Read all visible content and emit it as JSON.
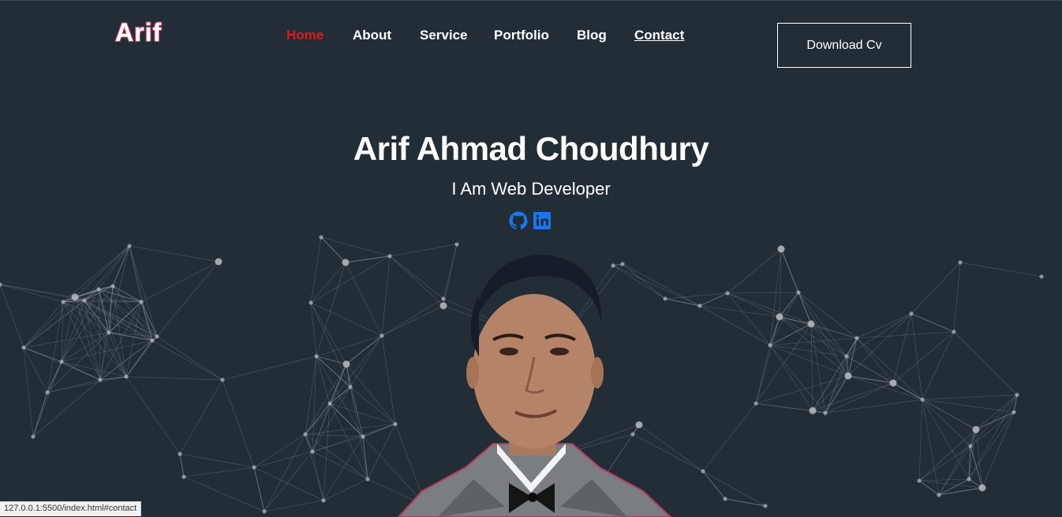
{
  "brand": {
    "logo_text": "Arif"
  },
  "nav": {
    "items": [
      {
        "label": "Home",
        "state": "active"
      },
      {
        "label": "About",
        "state": "normal"
      },
      {
        "label": "Service",
        "state": "normal"
      },
      {
        "label": "Portfolio",
        "state": "normal"
      },
      {
        "label": "Blog",
        "state": "normal"
      },
      {
        "label": "Contact",
        "state": "hovered"
      }
    ],
    "cta_label": "Download Cv"
  },
  "hero": {
    "name": "Arif Ahmad Choudhury",
    "role": "I Am Web Developer",
    "socials": [
      {
        "icon": "github-icon"
      },
      {
        "icon": "linkedin-icon"
      }
    ],
    "portrait_icon": "profile-photo"
  },
  "status_bar": {
    "url": "127.0.0.1:5500/index.html#contact"
  },
  "colors": {
    "background": "#222d36",
    "accent_active": "#e01b1b",
    "logo_stroke": "#d8345f",
    "social_icon": "#1877f2",
    "network_line": "#8d96a0",
    "network_dot": "#b8bcc1"
  }
}
